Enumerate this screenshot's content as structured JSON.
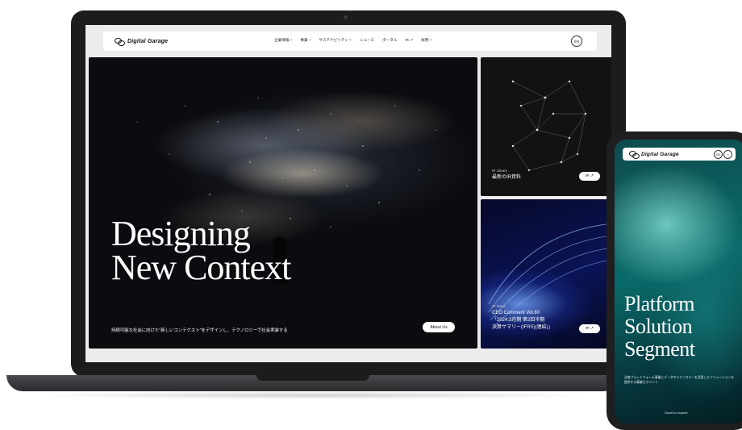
{
  "brand": "Digital Garage",
  "nav": {
    "items": [
      "企業情報 +",
      "事業 +",
      "サステナビリティ +",
      "ニュース",
      "ポータル",
      "IR ↗",
      "採用 +"
    ],
    "lang": "EN"
  },
  "hero": {
    "title_line1": "Designing",
    "title_line2": "New Context",
    "subtitle": "持続可能な社会に向けた\"新しいコンテクスト\"をデザインし、テクノロジーで社会実装する",
    "button": "About Us"
  },
  "ir_library": {
    "label": "IR Library",
    "title": "最新のIR資料",
    "button": "IR ↗"
  },
  "ir_news": {
    "label": "IR News",
    "title_line1": "CEO Comment Vol.80",
    "title_line2": "「2024.3月期 第2四半期",
    "title_line3": "決算サマリー(IFRS)(連結)」",
    "button": "IR ↗"
  },
  "phone": {
    "brand": "Digital Garage",
    "lang": "EN",
    "title_line1": "Platform",
    "title_line2": "Solution",
    "title_line3": "Segment",
    "desc": "決済プラットフォーム事業にデータやテクノロジーを活用したソリューションを提供する事業セグメント",
    "scroll": "Scroll to explore"
  }
}
